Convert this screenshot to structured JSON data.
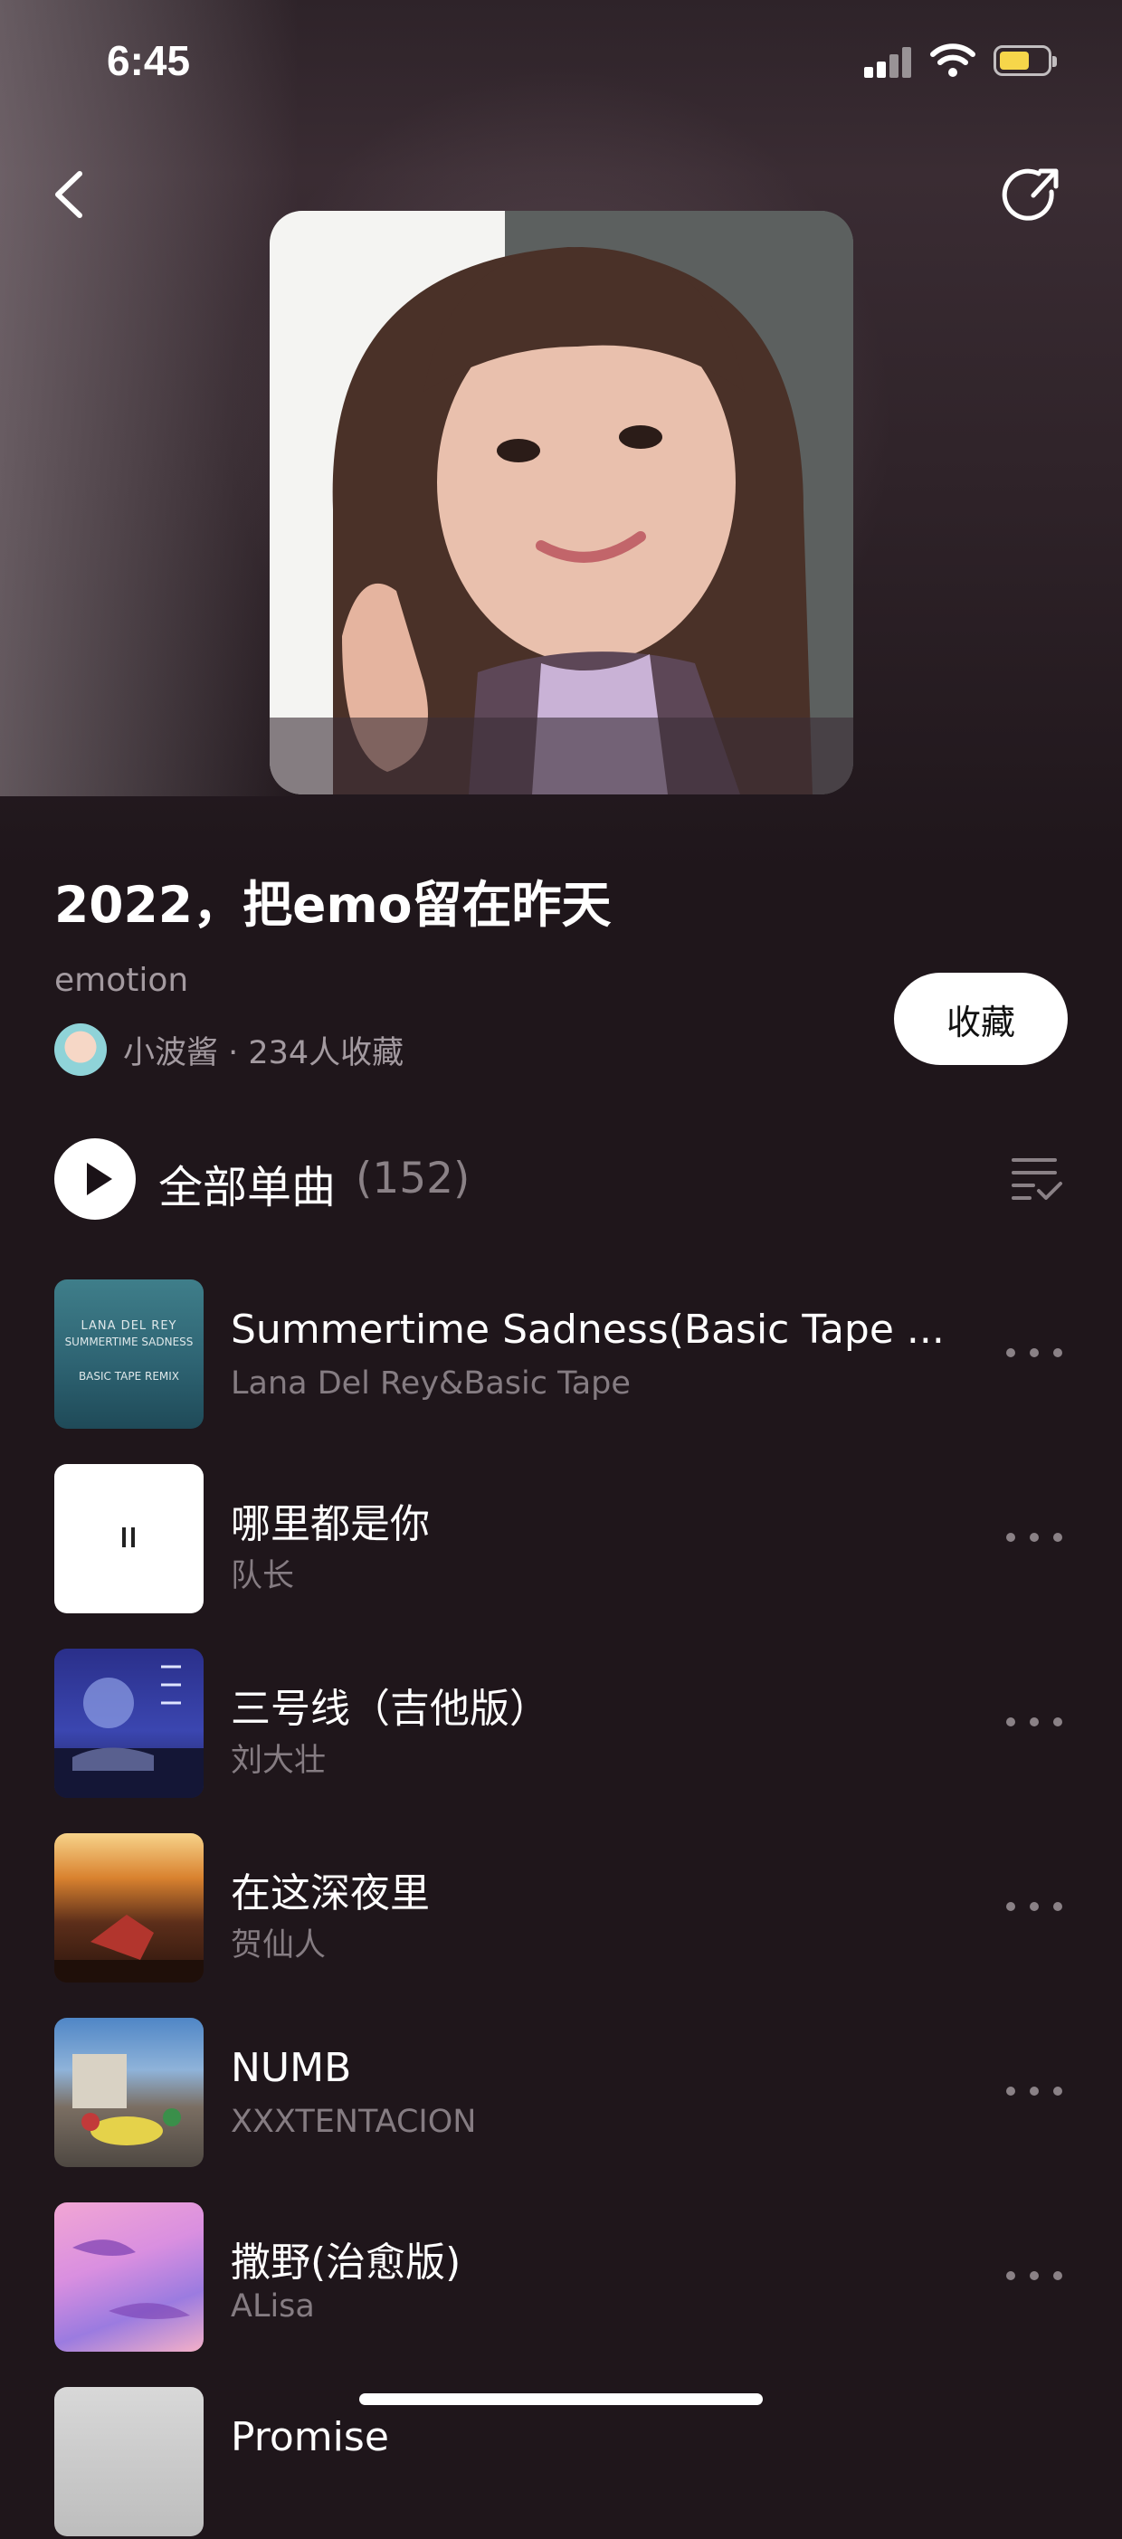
{
  "status_bar": {
    "time": "6:45"
  },
  "playlist": {
    "title": "2022，把emo留在昨天",
    "subtitle": "emotion",
    "creator_line": "小波酱 · 234人收藏",
    "collect_label": "收藏",
    "playall_label": "全部单曲",
    "track_count": "(152)"
  },
  "songs": [
    {
      "title": "Summertime Sadness(Basic Tape ...",
      "artist": "Lana Del Rey&Basic Tape",
      "cover_text_1": "LANA DEL REY",
      "cover_text_2": "SUMMERTIME SADNESS",
      "cover_text_3": "BASIC TAPE REMIX"
    },
    {
      "title": "哪里都是你",
      "artist": "队长"
    },
    {
      "title": "三号线（吉他版）",
      "artist": "刘大壮"
    },
    {
      "title": "在这深夜里",
      "artist": "贺仙人"
    },
    {
      "title": "NUMB",
      "artist": "XXXTENTACION"
    },
    {
      "title": "撒野(治愈版)",
      "artist": "ALisa"
    },
    {
      "title": "Promise"
    }
  ],
  "colors": {
    "background": "#1f161b",
    "secondary_text": "#857c82",
    "battery": "#f6d64a"
  }
}
